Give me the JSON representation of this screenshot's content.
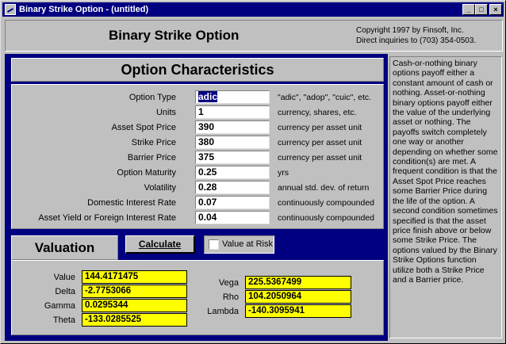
{
  "window": {
    "title": "Binary Strike Option - (untitled)",
    "buttons": {
      "minimize": "_",
      "maximize": "□",
      "close": "×"
    }
  },
  "header": {
    "title": "Binary Strike Option",
    "copyright_line1": "Copyright 1997 by Finsoft, Inc.",
    "copyright_line2": "Direct inquiries to (703) 354-0503."
  },
  "option_characteristics": {
    "title": "Option Characteristics",
    "rows": [
      {
        "label": "Option Type",
        "value": "adic",
        "unit": "\"adic\", \"adop\", \"cuic\", etc."
      },
      {
        "label": "Units",
        "value": "1",
        "unit": "currency, shares, etc."
      },
      {
        "label": "Asset Spot Price",
        "value": "390",
        "unit": "currency per asset unit"
      },
      {
        "label": "Strike Price",
        "value": "380",
        "unit": "currency per asset unit"
      },
      {
        "label": "Barrier Price",
        "value": "375",
        "unit": "currency per asset unit"
      },
      {
        "label": "Option Maturity",
        "value": "0.25",
        "unit": "yrs"
      },
      {
        "label": "Volatility",
        "value": "0.28",
        "unit": "annual std. dev. of return"
      },
      {
        "label": "Domestic Interest Rate",
        "value": "0.07",
        "unit": "continuously compounded"
      },
      {
        "label": "Asset Yield or Foreign Interest Rate",
        "value": "0.04",
        "unit": "continuously compounded"
      }
    ]
  },
  "valuation": {
    "title": "Valuation",
    "calculate_label": "Calculate",
    "var_label": "Value at Risk",
    "var_checked": false,
    "left": [
      {
        "label": "Value",
        "value": "144.4171475"
      },
      {
        "label": "Delta",
        "value": "-2.7753066"
      },
      {
        "label": "Gamma",
        "value": "0.0295344"
      },
      {
        "label": "Theta",
        "value": "-133.0285525"
      }
    ],
    "right": [
      {
        "label": "Vega",
        "value": "225.5367499"
      },
      {
        "label": "Rho",
        "value": "104.2050964"
      },
      {
        "label": "Lambda",
        "value": "-140.3095941"
      }
    ]
  },
  "description": "Cash-or-nothing binary options payoff either a constant amount of cash or nothing.  Asset-or-nothing binary options payoff either the value of the underlying asset or nothing.  The payoffs switch completely one way or another depending on whether some condition(s) are met.  A frequent condition is that the Asset Spot Price reaches some Barrier Price during the life of the option.  A second condition sometimes specified is that the asset price finish above or below some Strike Price.  The options valued by the Binary Strike Options function utilize both a Strike Price and a Barrier price.",
  "colors": {
    "titlebar": "#000080",
    "panel_bg": "#000080",
    "output_field": "#ffff00"
  }
}
